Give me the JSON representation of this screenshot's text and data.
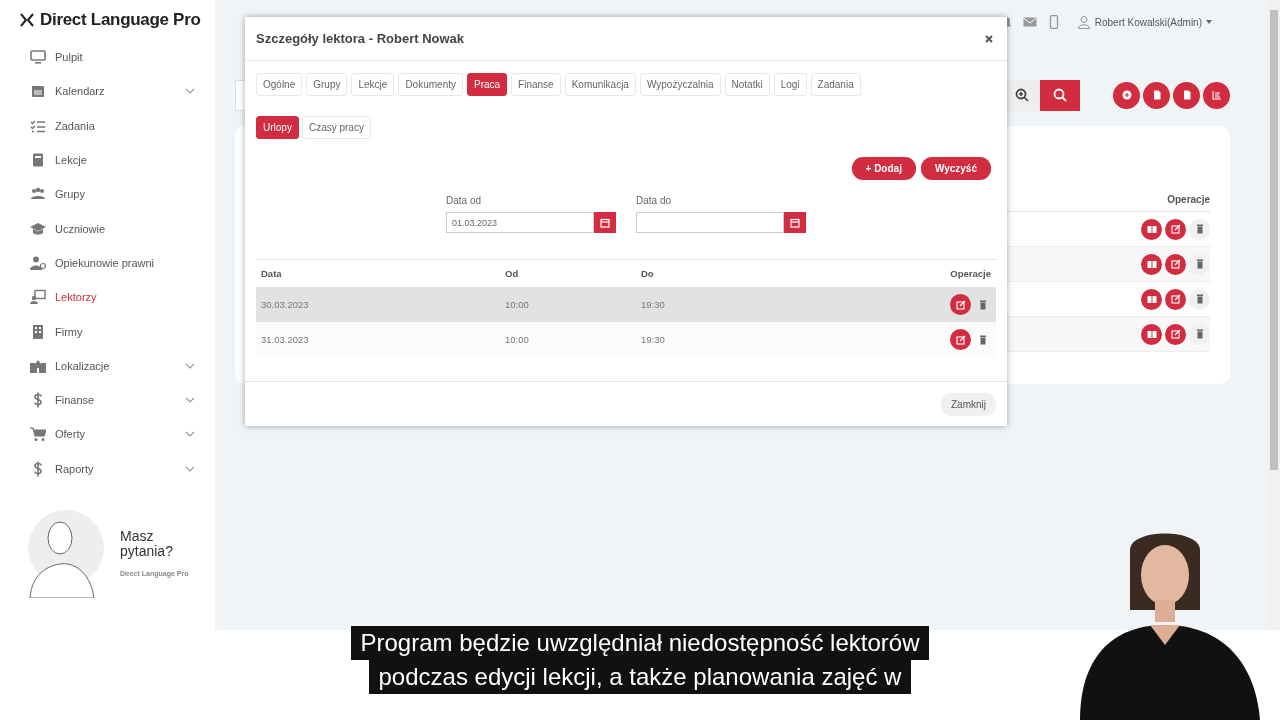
{
  "brand": {
    "name": "Direct Language Pro"
  },
  "sidebar": {
    "items": [
      {
        "label": "Pulpit",
        "expandable": false,
        "selected": false
      },
      {
        "label": "Kalendarz",
        "expandable": true,
        "selected": false
      },
      {
        "label": "Zadania",
        "expandable": false,
        "selected": false
      },
      {
        "label": "Lekcje",
        "expandable": false,
        "selected": false
      },
      {
        "label": "Grupy",
        "expandable": false,
        "selected": false
      },
      {
        "label": "Uczniowie",
        "expandable": false,
        "selected": false
      },
      {
        "label": "Opiekunowie prawni",
        "expandable": false,
        "selected": false
      },
      {
        "label": "Lektorzy",
        "expandable": false,
        "selected": true
      },
      {
        "label": "Firmy",
        "expandable": false,
        "selected": false
      },
      {
        "label": "Lokalizacje",
        "expandable": true,
        "selected": false
      },
      {
        "label": "Finanse",
        "expandable": true,
        "selected": false
      },
      {
        "label": "Oferty",
        "expandable": true,
        "selected": false
      },
      {
        "label": "Raporty",
        "expandable": true,
        "selected": false
      }
    ],
    "promo": {
      "title": "Masz pytania?",
      "brand": "Direct Language Pro"
    }
  },
  "header": {
    "user": "Robert Kowalski(Admin)"
  },
  "background_table": {
    "columns": [
      "Operacje"
    ]
  },
  "modal": {
    "title": "Szczegóły lektora - Robert Nowak",
    "tabs": [
      {
        "label": "Ogólne",
        "selected": false
      },
      {
        "label": "Grupy",
        "selected": false
      },
      {
        "label": "Lekcje",
        "selected": false
      },
      {
        "label": "Dokumenty",
        "selected": false
      },
      {
        "label": "Praca",
        "selected": true
      },
      {
        "label": "Finanse",
        "selected": false
      },
      {
        "label": "Komunikacja",
        "selected": false
      },
      {
        "label": "Wypożyczalnia",
        "selected": false
      },
      {
        "label": "Notatki",
        "selected": false
      },
      {
        "label": "Logi",
        "selected": false
      },
      {
        "label": "Zadania",
        "selected": false
      }
    ],
    "subtabs": [
      {
        "label": "Urlopy",
        "selected": true
      },
      {
        "label": "Czasy pracy",
        "selected": false
      }
    ],
    "actions": [
      {
        "label": "+ Dodaj"
      },
      {
        "label": "Wyczyść"
      }
    ],
    "filters": [
      {
        "label": "Data od",
        "value": "01.03.2023"
      },
      {
        "label": "Data do"
      }
    ],
    "table": {
      "columns": [
        "Data",
        "Od",
        "Do",
        "Operacje"
      ],
      "rows": [
        {
          "cells": [
            "30.03.2023",
            "10:00",
            "19:30"
          ],
          "highlighted": true
        },
        {
          "cells": [
            "31.03.2023",
            "10:00",
            "19:30"
          ],
          "highlighted": false
        }
      ]
    },
    "footer_button": "Zamknij"
  },
  "subtitle": {
    "lines": [
      "Program będzie uwzględniał niedostępność lektorów",
      "podczas edycji lekcji, a także planowania zajęć w"
    ]
  }
}
